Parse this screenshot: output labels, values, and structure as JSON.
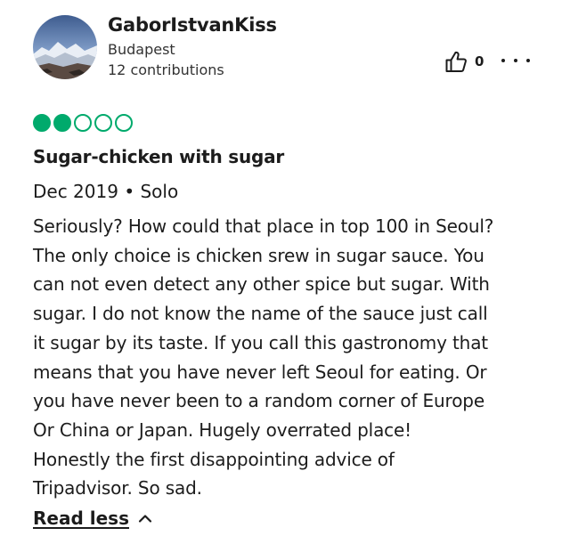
{
  "reviewer": {
    "name": "GaborIstvanKiss",
    "location": "Budapest",
    "contributions": "12 contributions",
    "avatar_icon": "mountain-landscape-avatar"
  },
  "actions": {
    "helpful_count": "0",
    "helpful_icon": "thumbs-up-icon",
    "more_icon": "ellipsis-icon"
  },
  "rating": {
    "value": 2,
    "max": 5,
    "color": "#00aa6c"
  },
  "review": {
    "title": "Sugar-chicken with sugar",
    "meta": "Dec 2019 • Solo",
    "lines": [
      "Seriously? How could that place in top 100 in Seoul?",
      "The only choice is chicken srew in sugar sauce. You",
      "can not even detect any other spice but sugar. With",
      "sugar. I do not know the name of the sauce just call",
      "it sugar by its taste. If you call this gastronomy that",
      "means that you have never left Seoul for eating. Or",
      "you have never been to a random corner of Europe",
      "Or China or Japan. Hugely overrated place!",
      "Honestly the first disappointing advice of",
      "Tripadvisor. So sad."
    ]
  },
  "read_less": {
    "label": "Read less",
    "icon": "chevron-up-icon"
  }
}
